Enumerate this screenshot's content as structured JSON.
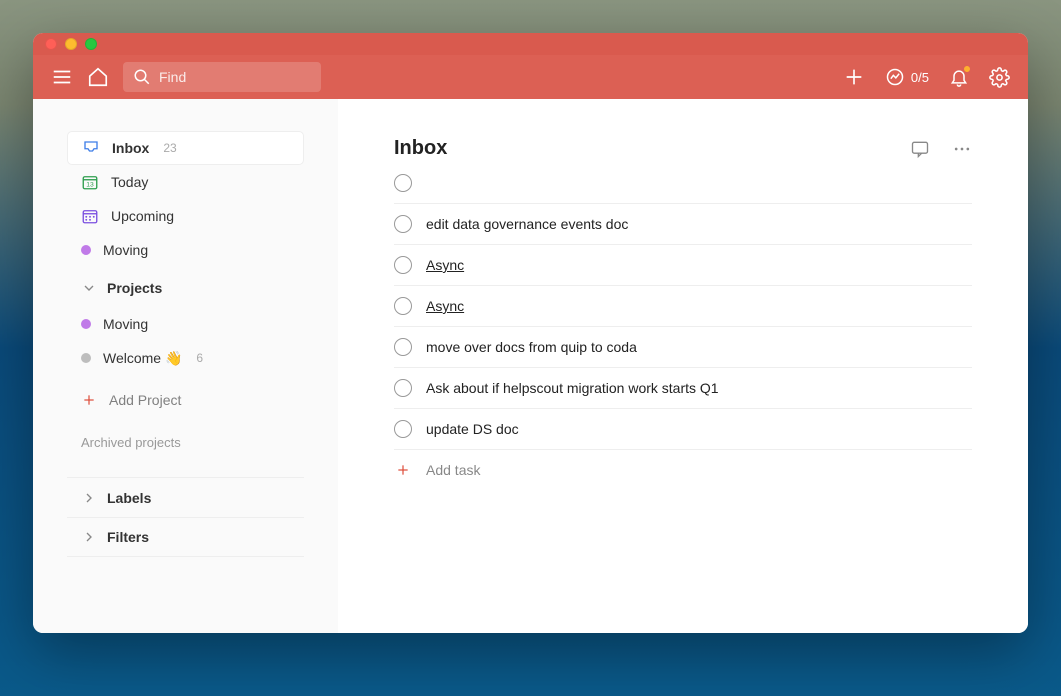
{
  "search": {
    "placeholder": "Find"
  },
  "productivity": {
    "label": "0/5"
  },
  "sidebar": {
    "inbox": {
      "label": "Inbox",
      "count": "23"
    },
    "today": {
      "label": "Today"
    },
    "upcoming": {
      "label": "Upcoming"
    },
    "fav_moving": {
      "label": "Moving",
      "color": "#c07ae8"
    },
    "projects_header": "Projects",
    "project_moving": {
      "label": "Moving",
      "color": "#c07ae8"
    },
    "project_welcome": {
      "label": "Welcome 👋",
      "count": "6",
      "color": "#bdbdbd"
    },
    "add_project": "Add Project",
    "archived": "Archived projects",
    "labels": "Labels",
    "filters": "Filters"
  },
  "main": {
    "title": "Inbox",
    "tasks": [
      {
        "title": "edit data governance events doc",
        "link": false
      },
      {
        "title": "Async",
        "link": true
      },
      {
        "title": "Async",
        "link": true
      },
      {
        "title": "move over docs from quip to coda",
        "link": false
      },
      {
        "title": "Ask about if helpscout migration work starts Q1",
        "link": false
      },
      {
        "title": "update DS doc",
        "link": false
      }
    ],
    "add_task": "Add task"
  }
}
